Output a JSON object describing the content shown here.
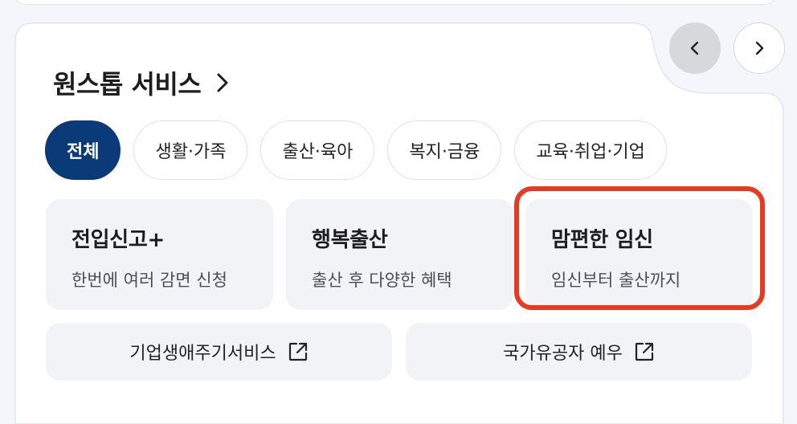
{
  "section": {
    "title": "원스톱 서비스"
  },
  "tabs": [
    {
      "label": "전체",
      "active": true
    },
    {
      "label": "생활·가족",
      "active": false
    },
    {
      "label": "출산·육아",
      "active": false
    },
    {
      "label": "복지·금융",
      "active": false
    },
    {
      "label": "교육·취업·기업",
      "active": false
    }
  ],
  "services": [
    {
      "name": "전입신고+",
      "desc": "한번에 여러 감면 신청"
    },
    {
      "name": "행복출산",
      "desc": "출산 후 다양한 혜택"
    },
    {
      "name": "맘편한 임신",
      "desc": "임신부터 출산까지"
    }
  ],
  "external_links": [
    {
      "label": "기업생애주기서비스",
      "icon": "external-link-icon"
    },
    {
      "label": "국가유공자 예우",
      "icon": "external-link-icon"
    }
  ],
  "colors": {
    "active_tab": "#0b3a78",
    "highlight": "#e63a21",
    "card_bg": "#f1f3f6"
  }
}
